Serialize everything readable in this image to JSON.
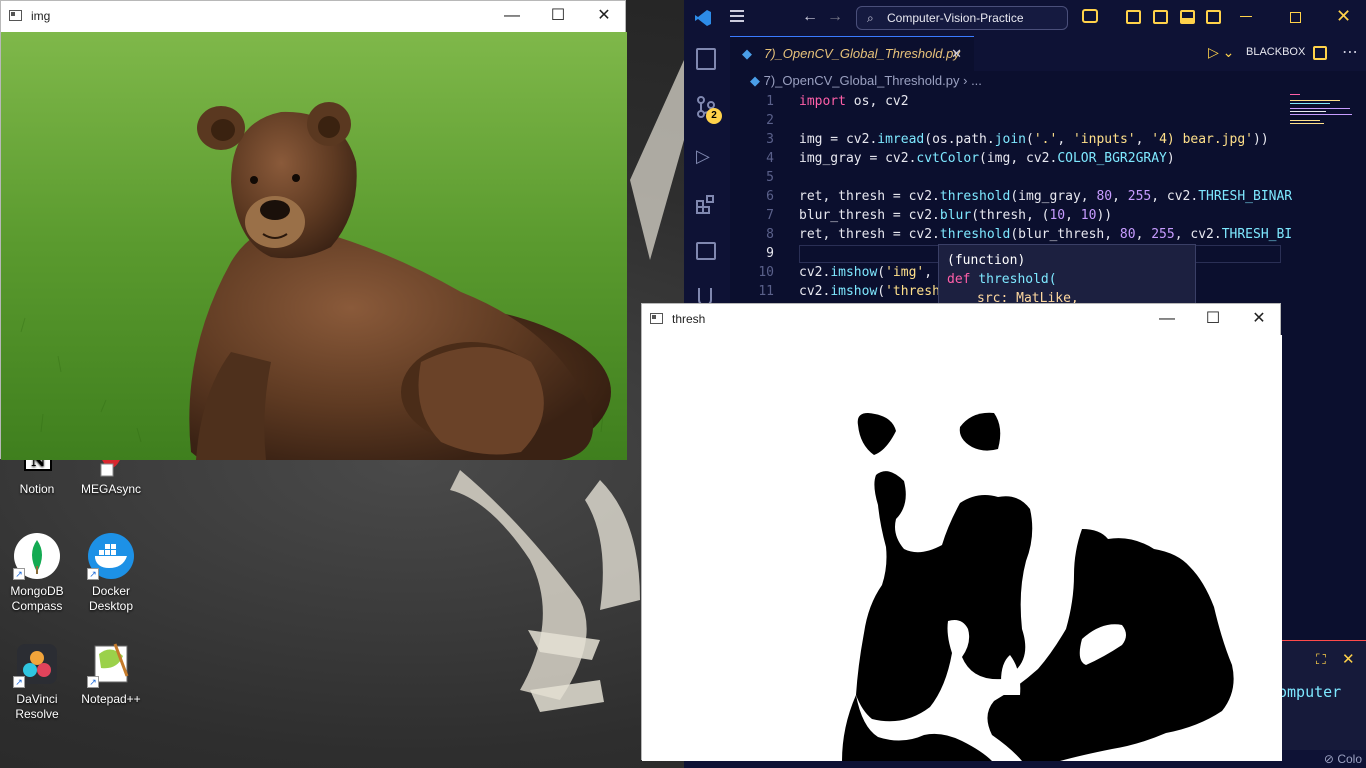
{
  "desktop": {
    "icons": [
      {
        "label": "Notion",
        "icon": "notion-icon"
      },
      {
        "label": "MEGAsync",
        "icon": "megasync-icon"
      },
      {
        "label": "MongoDB Compass",
        "icon": "mongodb-icon"
      },
      {
        "label": "Docker Desktop",
        "icon": "docker-icon"
      },
      {
        "label": "DaVinci Resolve",
        "icon": "davinci-icon"
      },
      {
        "label": "Notepad++",
        "icon": "notepadpp-icon"
      }
    ]
  },
  "img_window": {
    "title": "img",
    "image": "brown-bear-photo"
  },
  "thresh_window": {
    "title": "thresh",
    "image": "thresholded-bear-silhouette"
  },
  "vscode": {
    "search_text": "Computer-Vision-Practice",
    "tab_label": "7)_OpenCV_Global_Threshold.py",
    "breadcrumb_file": "7)_OpenCV_Global_Threshold.py",
    "breadcrumb_more": "...",
    "blackbox_label": "BLACKBOX",
    "scm_badge": "2",
    "lines": [
      {
        "num": "1"
      },
      {
        "num": "2"
      },
      {
        "num": "3"
      },
      {
        "num": "4"
      },
      {
        "num": "5"
      },
      {
        "num": "6"
      },
      {
        "num": "7"
      },
      {
        "num": "8"
      },
      {
        "num": "9"
      },
      {
        "num": "10"
      },
      {
        "num": "11"
      }
    ],
    "hover": {
      "line1": "(function)",
      "line2_kw": "def",
      "line2_fn": "threshold(",
      "line3": "src: MatLike,"
    },
    "panel_text": "omputer",
    "status_right": "Colo"
  },
  "colors": {
    "vscode_bg": "#0b0f2e",
    "accent": "#3a7bff",
    "keyword": "#ff5fa8",
    "function": "#7ee8ff"
  }
}
